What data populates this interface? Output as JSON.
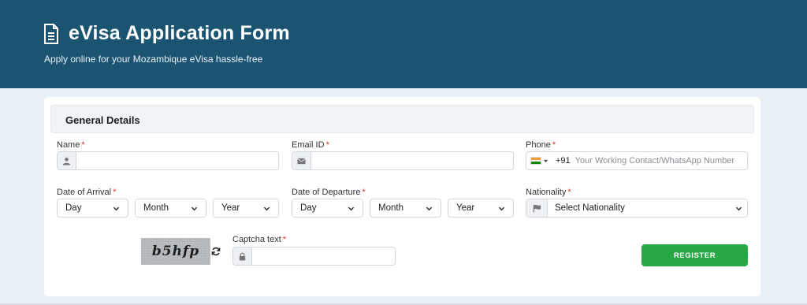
{
  "header": {
    "title": "eVisa Application Form",
    "subtitle": "Apply online for your Mozambique eVisa hassle-free",
    "bg_color": "#1b5470"
  },
  "section": {
    "title": "General Details"
  },
  "fields": {
    "name": {
      "label": "Name",
      "required": "*",
      "value": "",
      "icon": "user-icon"
    },
    "email": {
      "label": "Email ID",
      "required": "*",
      "value": "",
      "icon": "envelope-icon"
    },
    "phone": {
      "label": "Phone",
      "required": "*",
      "country_code": "+91",
      "placeholder": "Your Working Contact/WhatsApp Number",
      "flag": "india-flag"
    },
    "arrival": {
      "label": "Date of Arrival",
      "required": "*",
      "day": "Day",
      "month": "Month",
      "year": "Year"
    },
    "departure": {
      "label": "Date of Departure",
      "required": "*",
      "day": "Day",
      "month": "Month",
      "year": "Year"
    },
    "nationality": {
      "label": "Nationality",
      "required": "*",
      "selected": "Select Nationality",
      "icon": "flag-icon"
    },
    "captcha": {
      "label": "Captcha text",
      "required": "*",
      "image_text": "b5hfp",
      "value": "",
      "icon": "lock-icon"
    }
  },
  "actions": {
    "register_label": "REGISTER",
    "register_color": "#28a745"
  }
}
